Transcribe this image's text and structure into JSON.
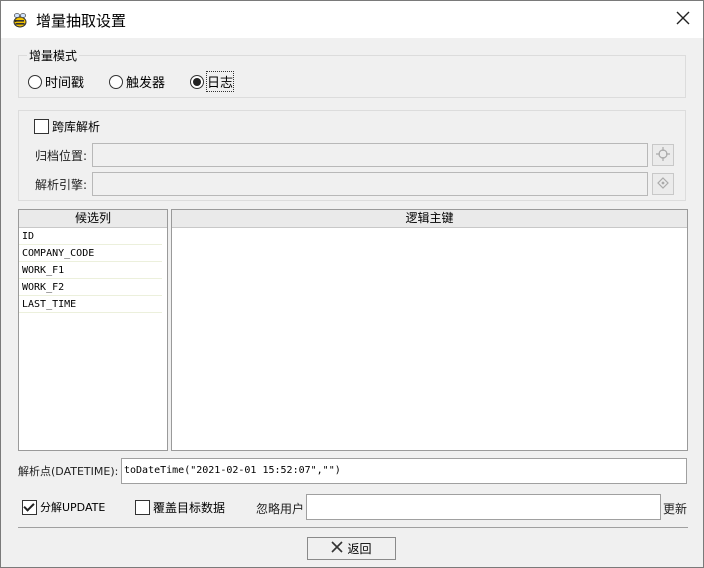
{
  "window": {
    "title": "增量抽取设置"
  },
  "mode_group": {
    "label": "增量模式",
    "options": [
      {
        "label": "时间戳",
        "selected": false
      },
      {
        "label": "触发器",
        "selected": false
      },
      {
        "label": "日志",
        "selected": true
      }
    ]
  },
  "cross_db": {
    "checkbox_label": "跨库解析",
    "checked": false,
    "archive_label": "归档位置:",
    "archive_value": "",
    "engine_label": "解析引擎:",
    "engine_value": ""
  },
  "candidates": {
    "header": "候选列",
    "items": [
      "ID",
      "COMPANY_CODE",
      "WORK_F1",
      "WORK_F2",
      "LAST_TIME"
    ]
  },
  "logical_keys": {
    "header": "逻辑主键",
    "items": []
  },
  "parse_point": {
    "label": "解析点(DATETIME):",
    "value": "toDateTime(\"2021-02-01 15:52:07\",\"\")"
  },
  "options": {
    "split_update": {
      "label": "分解UPDATE",
      "checked": true
    },
    "overwrite": {
      "label": "覆盖目标数据",
      "checked": false
    },
    "ignore_users_label": "忽略用户",
    "ignore_users_value": "",
    "update_link": "更新"
  },
  "footer": {
    "back_label": "返回"
  }
}
